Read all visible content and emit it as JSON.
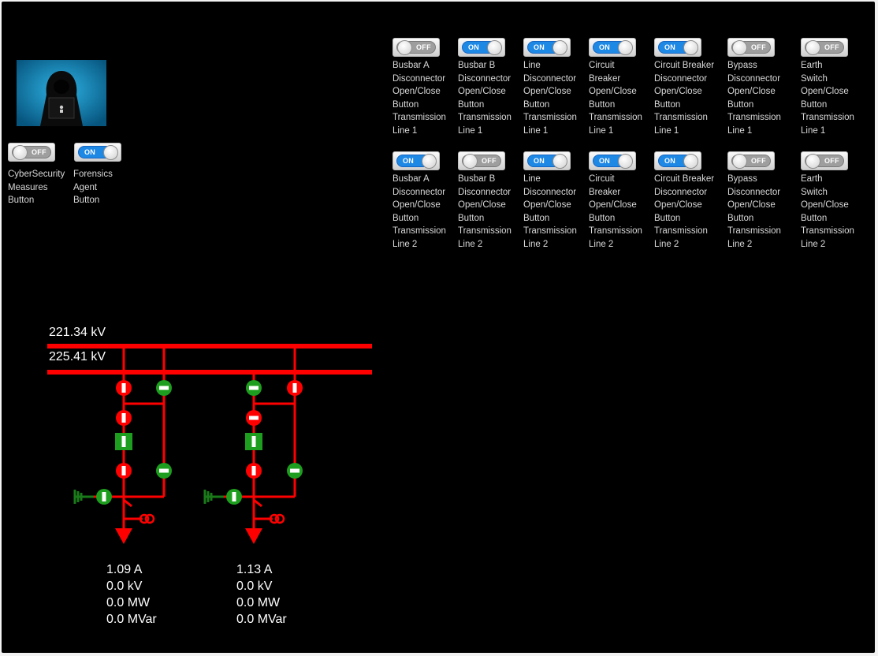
{
  "left_controls": [
    {
      "label": "CyberSecurity\nMeasures\nButton",
      "state": "OFF"
    },
    {
      "label": "Forensics\nAgent\nButton",
      "state": "ON"
    }
  ],
  "switch_rows": [
    {
      "buttons": [
        {
          "label": "Busbar A\nDisconnector\nOpen/Close\nButton\nTransmission\nLine 1",
          "state": "OFF"
        },
        {
          "label": "Busbar B\nDisconnector\nOpen/Close\nButton\nTransmission\nLine 1",
          "state": "ON"
        },
        {
          "label": "Line\nDisconnector\nOpen/Close\nButton\nTransmission\nLine 1",
          "state": "ON"
        },
        {
          "label": "Circuit\nBreaker\nOpen/Close\nButton\nTransmission\nLine 1",
          "state": "ON"
        },
        {
          "label": "Circuit Breaker\nDisconnector\nOpen/Close\nButton\nTransmission\nLine 1",
          "state": "ON"
        },
        {
          "label": "Bypass\nDisconnector\nOpen/Close\nButton\nTransmission\nLine 1",
          "state": "OFF"
        },
        {
          "label": "Earth\nSwitch\nOpen/Close\nButton\nTransmission\nLine 1",
          "state": "OFF"
        }
      ]
    },
    {
      "buttons": [
        {
          "label": "Busbar A\nDisconnector\nOpen/Close\nButton\nTransmission\nLine 2",
          "state": "ON"
        },
        {
          "label": "Busbar B\nDisconnector\nOpen/Close\nButton\nTransmission\nLine 2",
          "state": "OFF"
        },
        {
          "label": "Line\nDisconnector\nOpen/Close\nButton\nTransmission\nLine 2",
          "state": "ON"
        },
        {
          "label": "Circuit\nBreaker\nOpen/Close\nButton\nTransmission\nLine 2",
          "state": "ON"
        },
        {
          "label": "Circuit Breaker\nDisconnector\nOpen/Close\nButton\nTransmission\nLine 2",
          "state": "ON"
        },
        {
          "label": "Bypass\nDisconnector\nOpen/Close\nButton\nTransmission\nLine 2",
          "state": "OFF"
        },
        {
          "label": "Earth\nSwitch\nOpen/Close\nButton\nTransmission\nLine 2",
          "state": "OFF"
        }
      ]
    }
  ],
  "busbars": {
    "a_voltage": "221.34 kV",
    "b_voltage": "225.41 kV"
  },
  "feeders": [
    {
      "current": "1.09 A",
      "voltage": "0.0 kV",
      "active_power": "0.0 MW",
      "reactive_power": "0.0 MVar"
    },
    {
      "current": "1.13 A",
      "voltage": "0.0 kV",
      "active_power": "0.0 MW",
      "reactive_power": "0.0 MVar"
    }
  ],
  "colors": {
    "energized": "#ff0000",
    "closed_green": "#1e9e1e",
    "earth_green": "#1a7a1a",
    "background": "#000000"
  },
  "icons": {
    "avatar": "hooded-hacker-icon"
  }
}
